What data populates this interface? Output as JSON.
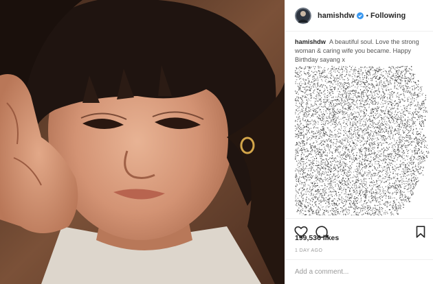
{
  "post": {
    "username": "hamishdw",
    "follow_separator": "•",
    "follow_label": "Following",
    "caption_username": "hamishdw",
    "caption_text": "A beautiful soul. Love the strong woman & caring wife you became. Happy Birthday sayang x",
    "likes": "199,536 likes",
    "timestamp": "1 DAY AGO",
    "comment_placeholder": "Add a comment..."
  },
  "icons": {
    "verified": "verified-badge-icon",
    "like": "heart-outline-icon",
    "comment": "speech-bubble-icon",
    "save": "bookmark-icon"
  },
  "colors": {
    "verified": "#3897f0",
    "text": "#262626",
    "muted": "#999999",
    "divider": "#efefef"
  }
}
